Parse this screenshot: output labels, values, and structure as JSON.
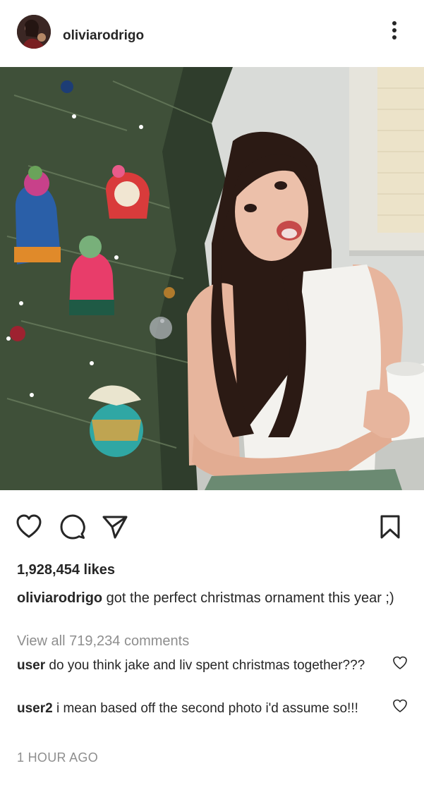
{
  "post": {
    "username": "oliviarodrigo",
    "likes": "1,928,454 likes",
    "caption_user": "oliviarodrigo",
    "caption_text": " got the perfect christmas ornament this year ;)",
    "view_all_comments": "View all 719,234 comments",
    "time_ago": "1 HOUR AGO"
  },
  "comments": [
    {
      "user": "user",
      "text": " do you think jake and liv spent christmas together???"
    },
    {
      "user": "user2",
      "text": " i mean based off the second photo i'd assume so!!!"
    }
  ],
  "icons": {
    "more": "more-options-icon",
    "like": "heart-icon",
    "comment": "comment-icon",
    "share": "send-icon",
    "save": "bookmark-icon"
  }
}
